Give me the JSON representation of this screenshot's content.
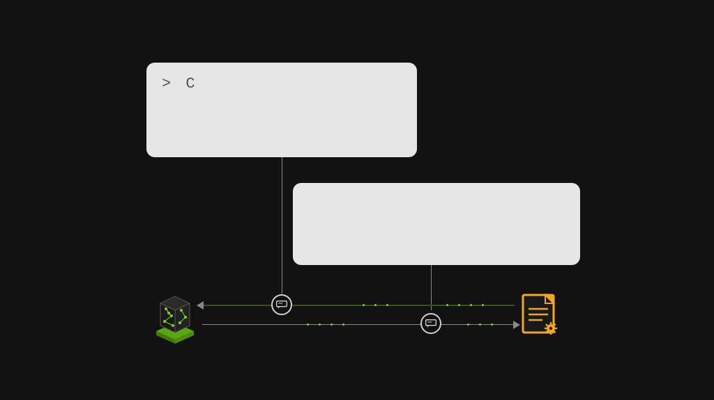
{
  "prompt_box": {
    "text": "> C"
  },
  "response_box": {
    "text": ""
  },
  "nodes": {
    "left_icon": "network-cube",
    "right_icon": "document-gear",
    "marker_left": "chat-bubble",
    "marker_right": "chat-bubble"
  },
  "colors": {
    "bg": "#121212",
    "card": "#e6e6e6",
    "accent_green": "#7ed321",
    "accent_orange": "#f5a623",
    "line": "#888888"
  }
}
